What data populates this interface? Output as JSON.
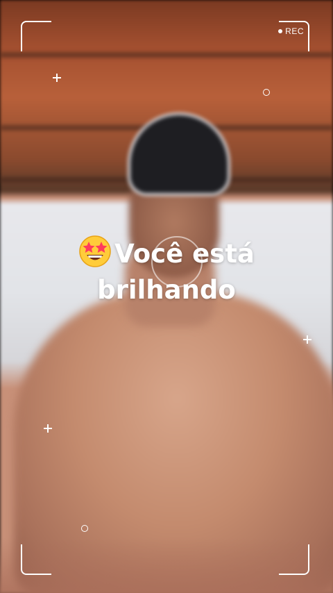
{
  "camera": {
    "rec_label": "REC"
  },
  "caption": {
    "emoji": "star-struck-emoji",
    "line1": "Você está",
    "line2": "brilhando"
  },
  "colors": {
    "overlay": "#ffffff",
    "emoji_face": "#ffcc3a",
    "emoji_eyes": "#ff3b5c"
  }
}
